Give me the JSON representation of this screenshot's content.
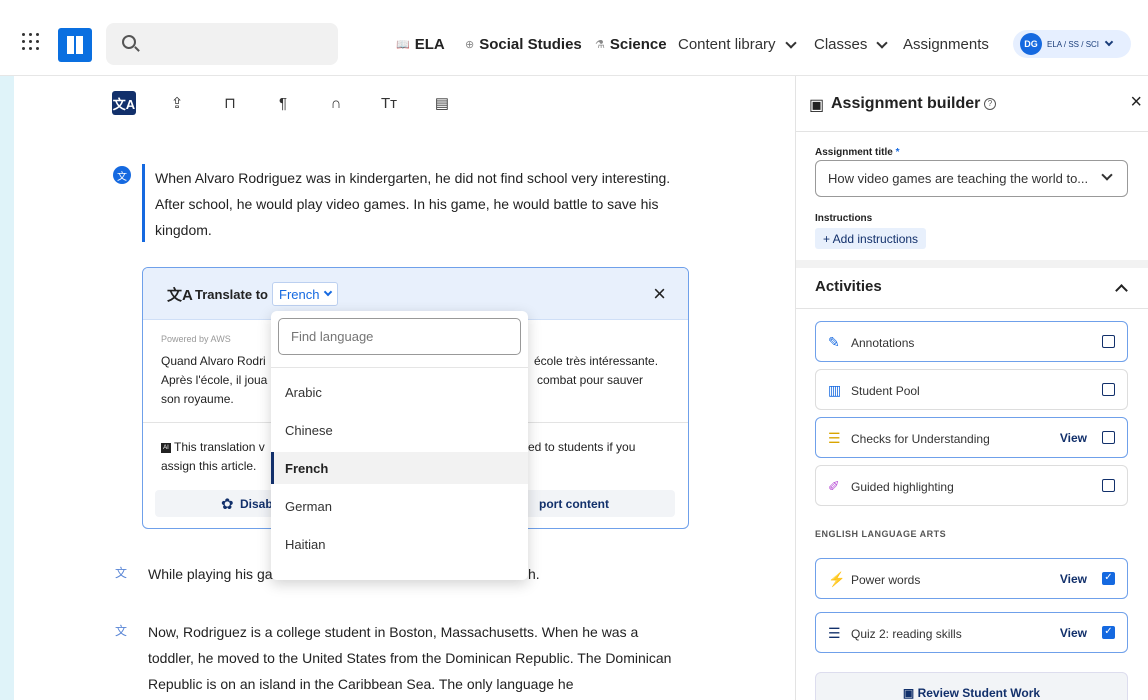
{
  "topbar": {
    "nav": {
      "ela": "ELA",
      "social": "Social Studies",
      "science": "Science",
      "content_library": "Content library",
      "classes": "Classes",
      "assignments": "Assignments"
    },
    "profile": {
      "initials": "DG",
      "label": "ELA / SS / SCI"
    }
  },
  "toolbar": {
    "icons": [
      "translate-icon",
      "share-icon",
      "bookmark-icon",
      "paragraph-icon",
      "headphones-icon",
      "text-size-icon",
      "notes-icon"
    ]
  },
  "article": {
    "p1": "When Alvaro Rodriguez was in kindergarten, he did not find school very interesting. After school, he would play video games. In his game, he would battle to save his kingdom.",
    "p2": "While playing his ga",
    "p2_tail": "h.",
    "p3": "Now, Rodriguez is a college student in Boston, Massachusetts. When he was a toddler, he moved to the United States from the Dominican Republic. The Dominican Republic is on an island in the Caribbean Sea. The only language he"
  },
  "translate": {
    "label": "Translate to",
    "language": "French",
    "powered": "Powered by AWS",
    "text_a1": "Quand Alvaro Rodri",
    "text_a2": "Après l'école, il joua",
    "text_a3": "son royaume.",
    "text_b1": "école très intéressante.",
    "text_b2": "combat pour sauver",
    "note_a1": "This translation v",
    "note_a2": "assign this article.",
    "note_b1": "ed to students if you",
    "disable_label": "Disab",
    "report_label": "port content"
  },
  "dropdown": {
    "placeholder": "Find language",
    "options": [
      "Arabic",
      "Chinese",
      "French",
      "German",
      "Haitian"
    ],
    "selected": "French"
  },
  "builder": {
    "title": "Assignment builder",
    "help": "?",
    "assignment_title_label": "Assignment title",
    "required": "*",
    "assignment_title_value": "How video games are teaching the world to...",
    "instructions_label": "Instructions",
    "add_instructions": "+ Add instructions",
    "activities_title": "Activities",
    "activities": [
      {
        "label": "Annotations",
        "icon": "pencil-icon",
        "checked": false,
        "view": ""
      },
      {
        "label": "Student Pool",
        "icon": "chart-icon",
        "checked": false,
        "view": ""
      },
      {
        "label": "Checks for Understanding",
        "icon": "list-icon",
        "checked": false,
        "view": "View"
      },
      {
        "label": "Guided highlighting",
        "icon": "highlighter-icon",
        "checked": false,
        "view": ""
      }
    ],
    "section_label": "ENGLISH LANGUAGE ARTS",
    "ela_activities": [
      {
        "label": "Power words",
        "icon": "bolt-icon",
        "checked": true,
        "view": "View"
      },
      {
        "label": "Quiz 2: reading skills",
        "icon": "quiz-list-icon",
        "checked": true,
        "view": "View"
      }
    ],
    "review": "Review Student Work"
  },
  "colors": {
    "accent": "#1569e0",
    "navy": "#12306b",
    "strip": "#dff3f9"
  }
}
